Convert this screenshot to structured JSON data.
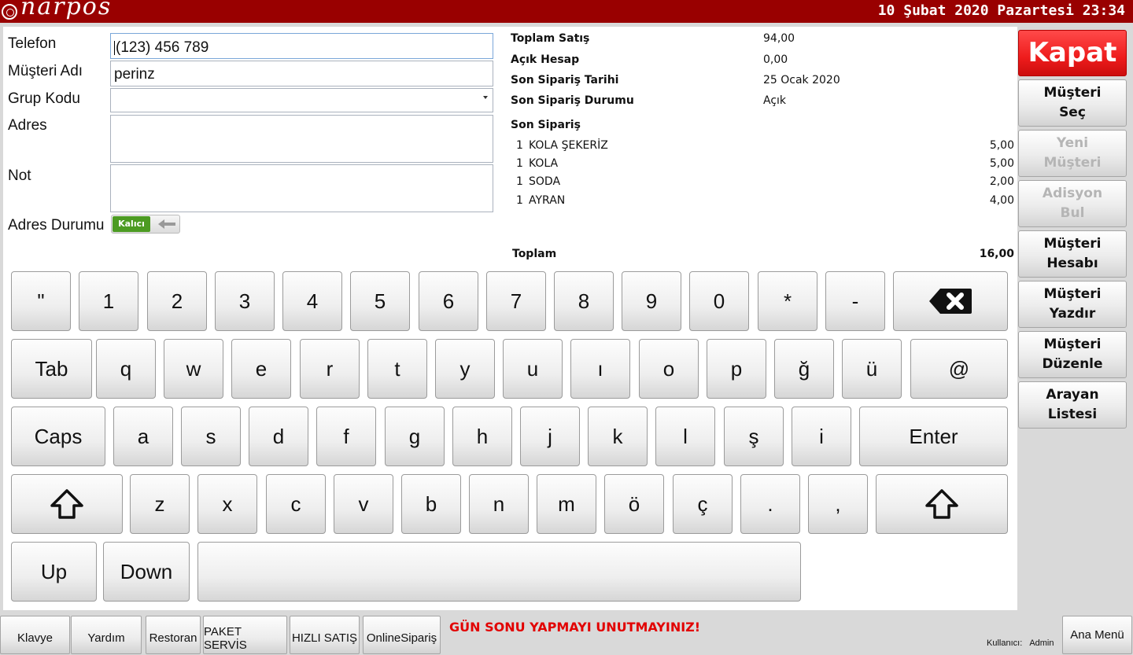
{
  "header": {
    "logo_text": "narpos",
    "datetime": "10 Şubat 2020 Pazartesi 23:34"
  },
  "form": {
    "phone_label": "Telefon",
    "phone_value": "(123) 456 789",
    "name_label": "Müşteri Adı",
    "name_value": "perinz",
    "group_label": "Grup Kodu",
    "group_value": "",
    "address_label": "Adres",
    "address_value": "",
    "note_label": "Not",
    "note_value": "",
    "address_status_label": "Adres Durumu",
    "address_status_value": "Kalıcı"
  },
  "summary": {
    "total_sales_label": "Toplam Satış",
    "total_sales_value": "94,00",
    "open_account_label": "Açık Hesap",
    "open_account_value": "0,00",
    "last_order_date_label": "Son Sipariş Tarihi",
    "last_order_date_value": "25 Ocak 2020",
    "last_order_status_label": "Son Sipariş Durumu",
    "last_order_status_value": "Açık",
    "last_order_label": "Son Sipariş",
    "items": [
      {
        "qty": "1",
        "name": "KOLA ŞEKERİZ",
        "price": "5,00"
      },
      {
        "qty": "1",
        "name": "KOLA",
        "price": "5,00"
      },
      {
        "qty": "1",
        "name": "SODA",
        "price": "2,00"
      },
      {
        "qty": "1",
        "name": "AYRAN",
        "price": "4,00"
      }
    ],
    "total_label": "Toplam",
    "total_value": "16,00"
  },
  "keyboard": {
    "row1": [
      "\"",
      "1",
      "2",
      "3",
      "4",
      "5",
      "6",
      "7",
      "8",
      "9",
      "0",
      "*",
      "-"
    ],
    "tab": "Tab",
    "row2": [
      "q",
      "w",
      "e",
      "r",
      "t",
      "y",
      "u",
      "ı",
      "o",
      "p",
      "ğ",
      "ü",
      "@"
    ],
    "caps": "Caps",
    "row3": [
      "a",
      "s",
      "d",
      "f",
      "g",
      "h",
      "j",
      "k",
      "l",
      "ş",
      "i"
    ],
    "enter": "Enter",
    "row4": [
      "z",
      "x",
      "c",
      "v",
      "b",
      "n",
      "m",
      "ö",
      "ç",
      ".",
      ","
    ],
    "up": "Up",
    "down": "Down"
  },
  "side": {
    "close": "Kapat",
    "select_customer": "Müşteri\nSeç",
    "new_customer": "Yeni\nMüşteri",
    "find_bill": "Adisyon\nBul",
    "customer_account": "Müşteri\nHesabı",
    "print_customer": "Müşteri Yazdır",
    "edit_customer": "Müşteri\nDüzenle",
    "caller_list": "Arayan\nListesi"
  },
  "bottom": {
    "keyboard": "Klavye",
    "help": "Yardım",
    "restaurant": "Restoran",
    "package_service": "PAKET SERVİS",
    "quick_sale": "HIZLI SATIŞ",
    "online_order": "OnlineSipariş",
    "warning": "GÜN SONU YAPMAYI UNUTMAYINIZ!",
    "user_label": "Kullanıcı:",
    "user_value": "Admin",
    "main_menu": "Ana Menü"
  },
  "colors": {
    "topbar": "#990000",
    "close_button": "#ee1c1c",
    "toggle_on": "#4c9b22",
    "warning": "#e20000"
  }
}
